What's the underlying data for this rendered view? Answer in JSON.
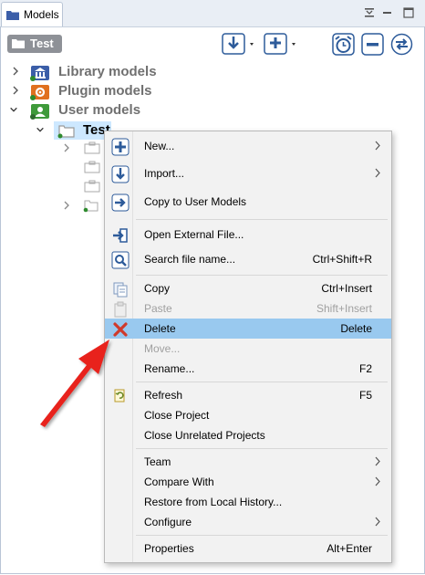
{
  "view": {
    "tab_label": "Models"
  },
  "toolbar": {
    "project_chip": "Test"
  },
  "tree": {
    "items": [
      {
        "label": "Library models",
        "icon": "library-icon",
        "expanded": false
      },
      {
        "label": "Plugin models",
        "icon": "plugin-icon",
        "expanded": false
      },
      {
        "label": "User models",
        "icon": "user-icon",
        "expanded": true
      },
      {
        "label": "Test",
        "icon": "project-folder-icon",
        "expanded": true
      }
    ]
  },
  "menu": {
    "new_label": "New...",
    "import_label": "Import...",
    "copy_user_label": "Copy to User Models",
    "open_external_label": "Open External File...",
    "search_label": "Search file name...",
    "search_shortcut": "Ctrl+Shift+R",
    "copy_label": "Copy",
    "copy_shortcut": "Ctrl+Insert",
    "paste_label": "Paste",
    "paste_shortcut": "Shift+Insert",
    "delete_label": "Delete",
    "delete_shortcut": "Delete",
    "move_label": "Move...",
    "rename_label": "Rename...",
    "rename_shortcut": "F2",
    "refresh_label": "Refresh",
    "refresh_shortcut": "F5",
    "close_project_label": "Close Project",
    "close_unrelated_label": "Close Unrelated Projects",
    "team_label": "Team",
    "compare_label": "Compare With",
    "restore_label": "Restore from Local History...",
    "configure_label": "Configure",
    "properties_label": "Properties",
    "properties_shortcut": "Alt+Enter"
  },
  "colors": {
    "selection": "#99c9ef",
    "annotation_arrow": "#e8201b"
  }
}
